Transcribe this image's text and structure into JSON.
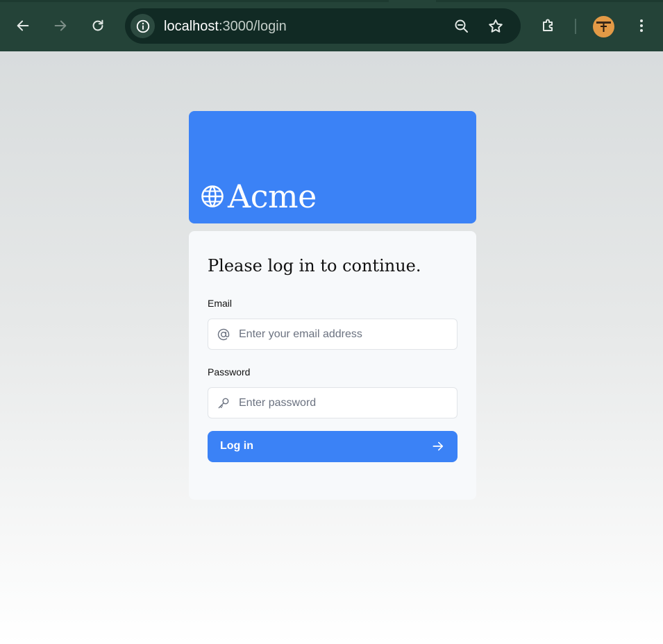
{
  "browser": {
    "url_host": "localhost",
    "url_rest": ":3000/login",
    "icons": {
      "back": "arrow-left-icon",
      "forward": "arrow-right-icon",
      "reload": "reload-icon",
      "site_info": "info-icon",
      "zoom": "zoom-out-icon",
      "bookmark": "star-icon",
      "extensions": "puzzle-icon",
      "menu": "more-vertical-icon"
    }
  },
  "brand": {
    "name": "Acme",
    "icon": "globe-icon",
    "color": "#3b82f6"
  },
  "login": {
    "title": "Please log in to continue.",
    "email_label": "Email",
    "email_placeholder": "Enter your email address",
    "email_value": "",
    "email_icon": "at-sign-icon",
    "password_label": "Password",
    "password_placeholder": "Enter password",
    "password_value": "",
    "password_icon": "key-icon",
    "submit_label": "Log in",
    "submit_icon": "arrow-right-icon",
    "accent": "#3b82f6"
  }
}
